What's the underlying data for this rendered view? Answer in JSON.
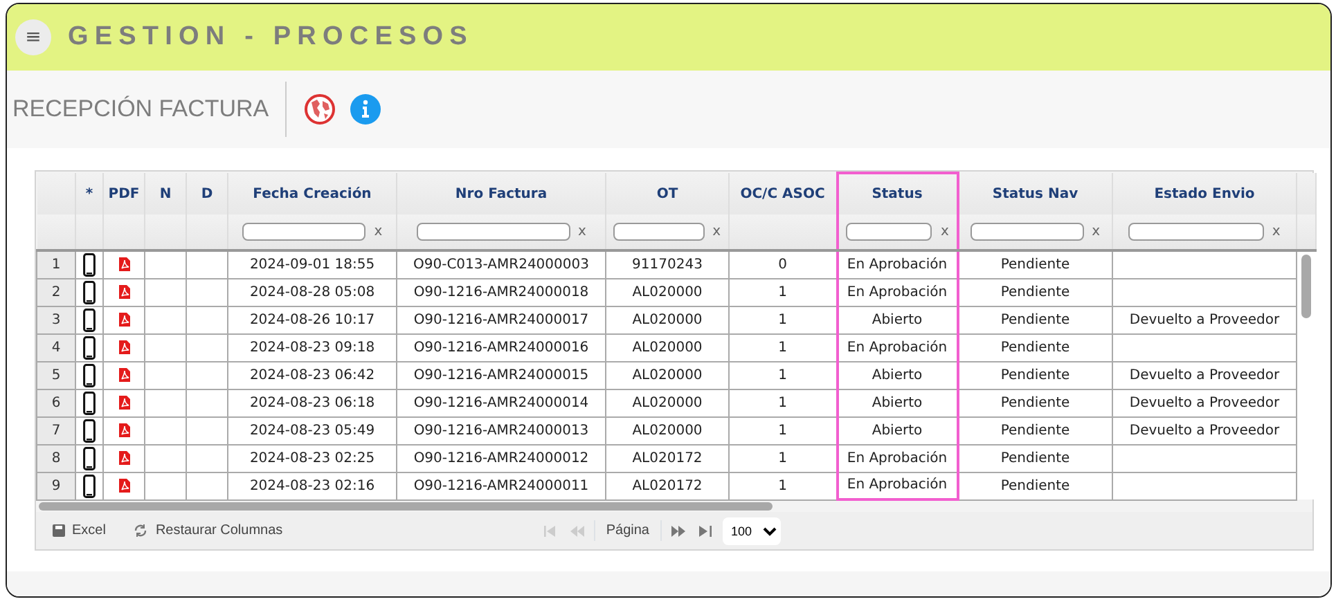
{
  "app_title": "GESTION - PROCESOS",
  "menu_button": "≡",
  "page_title": "RECEPCIÓN FACTURA",
  "columns": [
    {
      "kind": "row_number",
      "filter": false,
      "highlighted": false
    },
    {
      "kind": "phone",
      "label": "*",
      "filter": false,
      "highlighted": false
    },
    {
      "kind": "pdf",
      "label": "PDF",
      "filter": false,
      "highlighted": false
    },
    {
      "kind": "plain",
      "label": "N",
      "filter": false,
      "highlighted": false
    },
    {
      "kind": "plain",
      "label": "D",
      "filter": false,
      "highlighted": false
    },
    {
      "kind": "text",
      "label": "Fecha Creación",
      "filter": true,
      "clear": "x",
      "highlighted": false
    },
    {
      "kind": "text",
      "label": "Nro Factura",
      "filter": true,
      "clear": "x",
      "highlighted": false
    },
    {
      "kind": "text",
      "label": "OT",
      "filter": true,
      "clear": "x",
      "highlighted": false
    },
    {
      "kind": "text",
      "label": "OC/C ASOC",
      "filter": false,
      "highlighted": false
    },
    {
      "kind": "text",
      "label": "Status",
      "filter": true,
      "clear": "x",
      "highlighted": true
    },
    {
      "kind": "text",
      "label": "Status Nav",
      "filter": true,
      "clear": "x",
      "highlighted": false
    },
    {
      "kind": "text",
      "label": "Estado Envio",
      "filter": true,
      "clear": "x",
      "highlighted": false
    }
  ],
  "rows": [
    {
      "number": "1",
      "fecha_creacion": "2024-09-01 18:55",
      "nro_factura": "O90-C013-AMR24000003",
      "ot": "91170243",
      "oc_c_asoc": "0",
      "status": "En Aprobación",
      "status_nav": "Pendiente"
    },
    {
      "number": "2",
      "fecha_creacion": "2024-08-28 05:08",
      "nro_factura": "O90-1216-AMR24000018",
      "ot": "AL020000",
      "oc_c_asoc": "1",
      "status": "En Aprobación",
      "status_nav": "Pendiente"
    },
    {
      "number": "3",
      "fecha_creacion": "2024-08-26 10:17",
      "nro_factura": "O90-1216-AMR24000017",
      "ot": "AL020000",
      "oc_c_asoc": "1",
      "status": "Abierto",
      "status_nav": "Pendiente",
      "estado_envio": "Devuelto a Proveedor"
    },
    {
      "number": "4",
      "fecha_creacion": "2024-08-23 09:18",
      "nro_factura": "O90-1216-AMR24000016",
      "ot": "AL020000",
      "oc_c_asoc": "1",
      "status": "En Aprobación",
      "status_nav": "Pendiente"
    },
    {
      "number": "5",
      "fecha_creacion": "2024-08-23 06:42",
      "nro_factura": "O90-1216-AMR24000015",
      "ot": "AL020000",
      "oc_c_asoc": "1",
      "status": "Abierto",
      "status_nav": "Pendiente",
      "estado_envio": "Devuelto a Proveedor"
    },
    {
      "number": "6",
      "fecha_creacion": "2024-08-23 06:18",
      "nro_factura": "O90-1216-AMR24000014",
      "ot": "AL020000",
      "oc_c_asoc": "1",
      "status": "Abierto",
      "status_nav": "Pendiente",
      "estado_envio": "Devuelto a Proveedor"
    },
    {
      "number": "7",
      "fecha_creacion": "2024-08-23 05:49",
      "nro_factura": "O90-1216-AMR24000013",
      "ot": "AL020000",
      "oc_c_asoc": "1",
      "status": "Abierto",
      "status_nav": "Pendiente",
      "estado_envio": "Devuelto a Proveedor"
    },
    {
      "number": "8",
      "fecha_creacion": "2024-08-23 02:25",
      "nro_factura": "O90-1216-AMR24000012",
      "ot": "AL020172",
      "oc_c_asoc": "1",
      "status": "En Aprobación",
      "status_nav": "Pendiente"
    },
    {
      "number": "9",
      "fecha_creacion": "2024-08-23 02:16",
      "nro_factura": "O90-1216-AMR24000011",
      "ot": "AL020172",
      "oc_c_asoc": "1",
      "status": "En Aprobación",
      "status_nav": "Pendiente"
    }
  ],
  "footer": {
    "excel": "Excel",
    "restore": "Restaurar Columnas",
    "page_label": "Página",
    "page_size": "100",
    "first_disabled": true,
    "prev_disabled": true,
    "next_disabled": false,
    "last_disabled": false
  }
}
